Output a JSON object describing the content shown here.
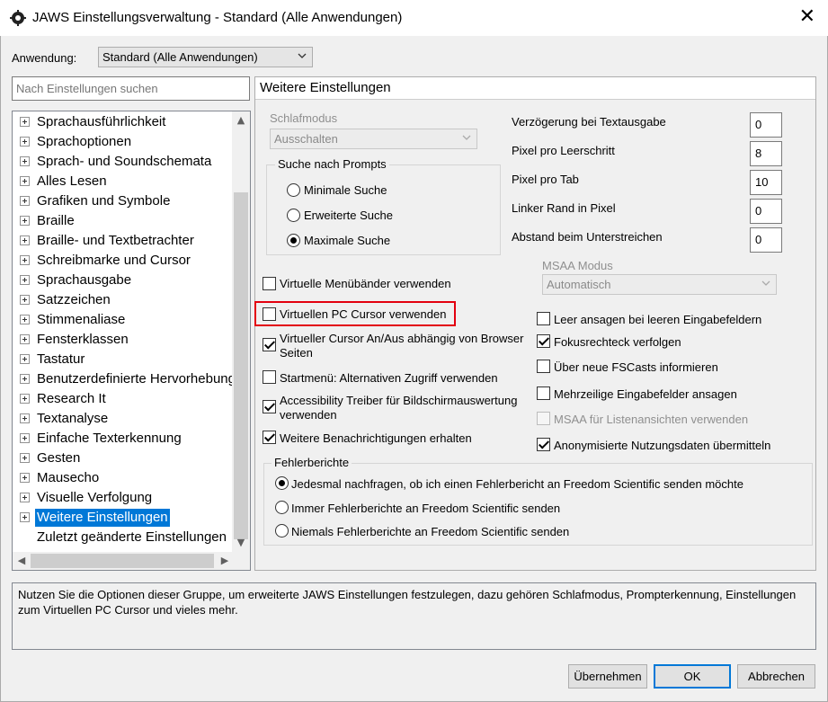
{
  "window": {
    "title": "JAWS Einstellungsverwaltung - Standard (Alle Anwendungen)",
    "close_glyph": "✕"
  },
  "application": {
    "label": "Anwendung:",
    "selected": "Standard (Alle Anwendungen)"
  },
  "search": {
    "placeholder": "Nach Einstellungen suchen"
  },
  "tree": {
    "items": [
      {
        "label": "Sprachausführlichkeit"
      },
      {
        "label": "Sprachoptionen"
      },
      {
        "label": "Sprach- und Soundschemata"
      },
      {
        "label": "Alles Lesen"
      },
      {
        "label": "Grafiken und Symbole"
      },
      {
        "label": "Braille"
      },
      {
        "label": "Braille- und Textbetrachter"
      },
      {
        "label": "Schreibmarke und Cursor"
      },
      {
        "label": "Sprachausgabe"
      },
      {
        "label": "Satzzeichen"
      },
      {
        "label": "Stimmenaliase"
      },
      {
        "label": "Fensterklassen"
      },
      {
        "label": "Tastatur"
      },
      {
        "label": "Benutzerdefinierte Hervorhebungen"
      },
      {
        "label": "Research It"
      },
      {
        "label": "Textanalyse"
      },
      {
        "label": "Einfache Texterkennung"
      },
      {
        "label": "Gesten"
      },
      {
        "label": "Mausecho"
      },
      {
        "label": "Visuelle Verfolgung"
      },
      {
        "label": "Weitere Einstellungen"
      },
      {
        "label": "Zuletzt geänderte Einstellungen"
      }
    ],
    "selected": "Weitere Einstellungen"
  },
  "panel": {
    "title": "Weitere Einstellungen",
    "sleep_mode": {
      "label": "Schlafmodus",
      "value": "Ausschalten"
    },
    "prompt_search": {
      "label": "Suche nach Prompts",
      "options": [
        "Minimale Suche",
        "Erweiterte Suche",
        "Maximale Suche"
      ],
      "selected": "Maximale Suche"
    },
    "numeric": [
      {
        "label": "Verzögerung bei Textausgabe",
        "value": "0"
      },
      {
        "label": "Pixel pro Leerschritt",
        "value": "8"
      },
      {
        "label": "Pixel pro Tab",
        "value": "10"
      },
      {
        "label": "Linker Rand in Pixel",
        "value": "0"
      },
      {
        "label": "Abstand beim Unterstreichen",
        "value": "0"
      }
    ],
    "msaa_mode": {
      "label": "MSAA Modus",
      "value": "Automatisch"
    },
    "left_checks": [
      {
        "label": "Virtuelle Menübänder verwenden",
        "checked": false
      },
      {
        "label": "Virtuellen PC Cursor verwenden",
        "checked": false
      },
      {
        "label": "Virtueller Cursor An/Aus abhängig von Browser",
        "label2": "Seiten",
        "checked": true
      },
      {
        "label": "Startmenü: Alternativen Zugriff verwenden",
        "checked": false
      },
      {
        "label": "Accessibility Treiber für Bildschirmauswertung",
        "label2": "verwenden",
        "checked": true
      },
      {
        "label": "Weitere Benachrichtigungen erhalten",
        "checked": true
      }
    ],
    "right_checks": [
      {
        "label": "Leer ansagen bei leeren Eingabefeldern",
        "checked": false
      },
      {
        "label": "Fokusrechteck verfolgen",
        "checked": true
      },
      {
        "label": "Über neue FSCasts informieren",
        "checked": false
      },
      {
        "label": "Mehrzeilige Eingabefelder ansagen",
        "checked": false
      },
      {
        "label": "MSAA für Listenansichten verwenden",
        "checked": false,
        "disabled": true
      },
      {
        "label": "Anonymisierte Nutzungsdaten übermitteln",
        "checked": true
      }
    ],
    "error_reports": {
      "label": "Fehlerberichte",
      "options": [
        "Jedesmal nachfragen, ob ich einen Fehlerbericht an Freedom Scientific senden möchte",
        "Immer Fehlerberichte an Freedom Scientific senden",
        "Niemals Fehlerberichte an Freedom Scientific senden"
      ],
      "selected": 0
    }
  },
  "description": "Nutzen Sie die Optionen dieser Gruppe, um erweiterte JAWS Einstellungen festzulegen, dazu gehören Schlafmodus, Prompterkennung, Einstellungen zum Virtuellen PC Cursor und vieles mehr.",
  "buttons": {
    "apply": "Übernehmen",
    "ok": "OK",
    "cancel": "Abbrechen"
  },
  "colors": {
    "selection": "#0078d7",
    "highlight_border": "#e3000f"
  }
}
